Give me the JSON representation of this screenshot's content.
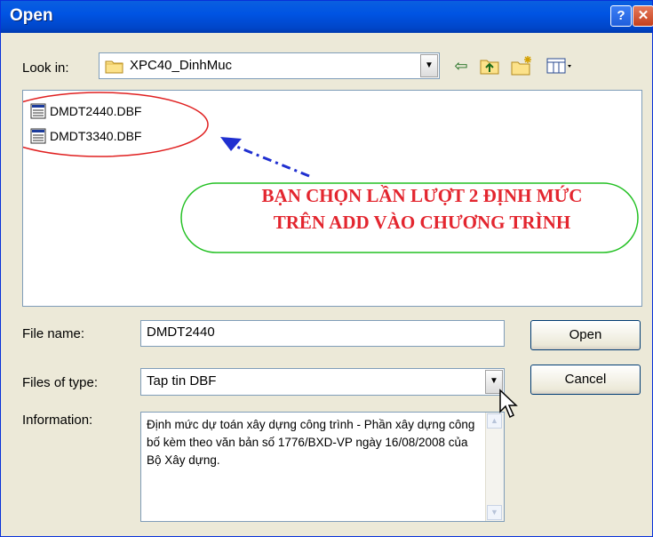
{
  "window": {
    "title": "Open"
  },
  "look_in": {
    "label": "Look in:",
    "value": "XPC40_DinhMuc"
  },
  "toolbar_icons": [
    "back-arrow-icon",
    "up-folder-icon",
    "new-folder-icon",
    "view-menu-icon"
  ],
  "files": [
    {
      "name": "DMDT2440.DBF"
    },
    {
      "name": "DMDT3340.DBF"
    }
  ],
  "annotation": {
    "line1": "BẠN CHỌN LẦN LƯỢT 2 ĐỊNH MỨC",
    "line2": "TRÊN ADD VÀO CHƯƠNG TRÌNH",
    "text_color": "#e3262f",
    "ellipse_color": "#e02020",
    "callout_border_color": "#22c022",
    "arrow_color": "#1f2fd0"
  },
  "file_name": {
    "label": "File name:",
    "value": "DMDT2440"
  },
  "files_of_type": {
    "label": "Files of type:",
    "value": "Tap tin DBF"
  },
  "information": {
    "label": "Information:",
    "text": "Định mức dự toán xây dựng công trình - Phần xây dựng công bố kèm theo văn bản số 1776/BXD-VP ngày 16/08/2008 của Bộ Xây dựng."
  },
  "buttons": {
    "open": "Open",
    "cancel": "Cancel"
  }
}
